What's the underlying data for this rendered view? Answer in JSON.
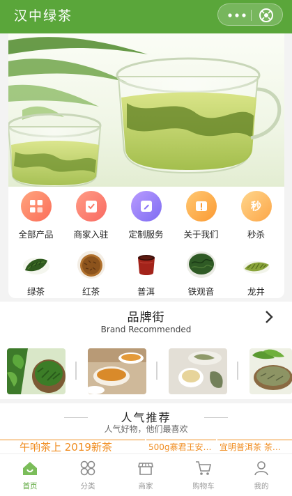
{
  "app": {
    "title": "汉中绿茶"
  },
  "capsule": {
    "more_icon": "more-dots-icon",
    "close_icon": "close-circle-icon"
  },
  "banner": {
    "image": "green-tea-glass-cups-photo"
  },
  "categories": [
    {
      "label": "全部产品",
      "icon": "grid-icon",
      "color_from": "#ffa57e",
      "color_to": "#fb6d59"
    },
    {
      "label": "商家入驻",
      "icon": "check-clipboard-icon",
      "color_from": "#ff9c85",
      "color_to": "#f96a62"
    },
    {
      "label": "定制服务",
      "icon": "edit-icon",
      "color_from": "#b99bff",
      "color_to": "#7d6cf2"
    },
    {
      "label": "关于我们",
      "icon": "exclamation-icon",
      "color_from": "#ffc872",
      "color_to": "#fb9a33"
    },
    {
      "label": "秒杀",
      "icon": "miaosha-text-icon",
      "icon_text": "秒",
      "color_from": "#ffd68c",
      "color_to": "#fca648"
    }
  ],
  "tea_types": [
    {
      "label": "绿茶",
      "icon": "green-tea-leaves-icon"
    },
    {
      "label": "红茶",
      "icon": "black-tea-leaves-icon"
    },
    {
      "label": "普洱",
      "icon": "puer-tea-cup-icon"
    },
    {
      "label": "铁观音",
      "icon": "tieguanyin-bowl-icon"
    },
    {
      "label": "龙井",
      "icon": "longjing-leaves-icon"
    }
  ],
  "brand": {
    "title": "品牌街",
    "subtitle": "Brand Recommended",
    "items": [
      {
        "name": "brand-tea-bush"
      },
      {
        "name": "brand-tea-cups"
      },
      {
        "name": "brand-tea-tray"
      },
      {
        "name": "brand-tea-leaves"
      }
    ]
  },
  "popular": {
    "title": "人气推荐",
    "subtitle": "人气好物，他们最喜欢",
    "items": [
      "午响茶上 2019新茶",
      "500g寨君王安…",
      "宜明普洱茶 茶…"
    ]
  },
  "tabs": [
    {
      "label": "首页",
      "icon": "home-icon",
      "active": true
    },
    {
      "label": "分类",
      "icon": "category-icon",
      "active": false
    },
    {
      "label": "商家",
      "icon": "store-icon",
      "active": false
    },
    {
      "label": "购物车",
      "icon": "cart-icon",
      "active": false
    },
    {
      "label": "我的",
      "icon": "user-icon",
      "active": false
    }
  ],
  "colors": {
    "brand_green": "#5aa63a",
    "accent_orange": "#f08c1f",
    "background": "#f3f3f3"
  }
}
